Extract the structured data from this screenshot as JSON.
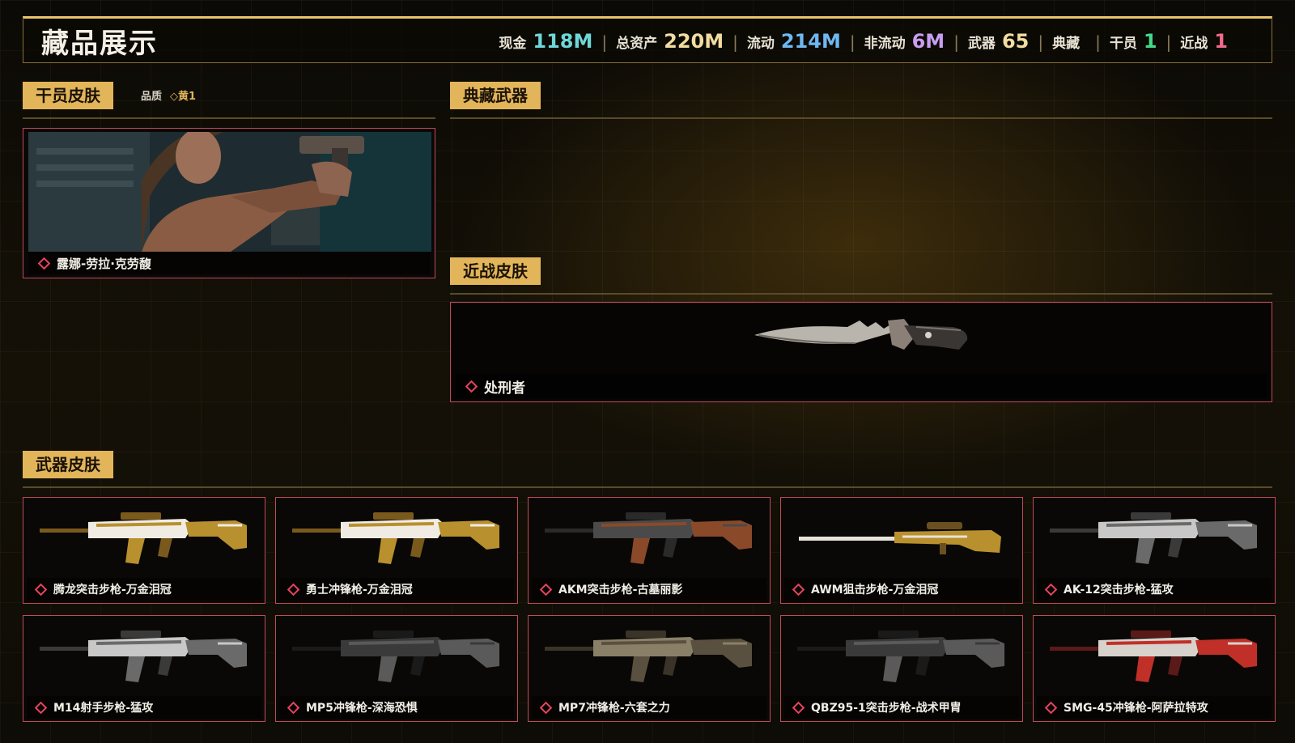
{
  "header": {
    "title": "藏品展示",
    "stats": [
      {
        "label": "现金",
        "value": "118M",
        "color": "#6fd6d8"
      },
      {
        "label": "总资产",
        "value": "220M",
        "color": "#f2dca0"
      },
      {
        "label": "流动",
        "value": "214M",
        "color": "#6fb8f0"
      },
      {
        "label": "非流动",
        "value": "6M",
        "color": "#c89ef0"
      },
      {
        "label": "武器",
        "value": "65",
        "color": "#f2dca0"
      },
      {
        "label": "典藏",
        "value": "",
        "color": "#f2dca0"
      },
      {
        "label": "干员",
        "value": "1",
        "color": "#46d88a"
      },
      {
        "label": "近战",
        "value": "1",
        "color": "#f06a8a"
      }
    ]
  },
  "sections": {
    "operator_skin": "干员皮肤",
    "collection_weapon": "典藏武器",
    "melee_skin": "近战皮肤",
    "weapon_skin": "武器皮肤"
  },
  "quality": {
    "label": "品质",
    "value": "黄1"
  },
  "operator": {
    "name": "露娜-劳拉·克劳馥"
  },
  "melee": {
    "name": "处刑者"
  },
  "weapons": [
    {
      "name": "腾龙突击步枪-万金泪冠",
      "style": "gold"
    },
    {
      "name": "勇士冲锋枪-万金泪冠",
      "style": "gold"
    },
    {
      "name": "AKM突击步枪-古墓丽影",
      "style": "wood"
    },
    {
      "name": "AWM狙击步枪-万金泪冠",
      "style": "sniper"
    },
    {
      "name": "AK-12突击步枪-猛攻",
      "style": "silver"
    },
    {
      "name": "M14射手步枪-猛攻",
      "style": "silver"
    },
    {
      "name": "MP5冲锋枪-深海恐惧",
      "style": "dark"
    },
    {
      "name": "MP7冲锋枪-六套之力",
      "style": "camo"
    },
    {
      "name": "QBZ95-1突击步枪-战术甲胄",
      "style": "dark"
    },
    {
      "name": "SMG-45冲锋枪-阿萨拉特攻",
      "style": "red"
    }
  ],
  "colors": {
    "accent_gold": "#e2b55a",
    "card_border": "#c04a5a",
    "diamond": "#e8445c"
  }
}
